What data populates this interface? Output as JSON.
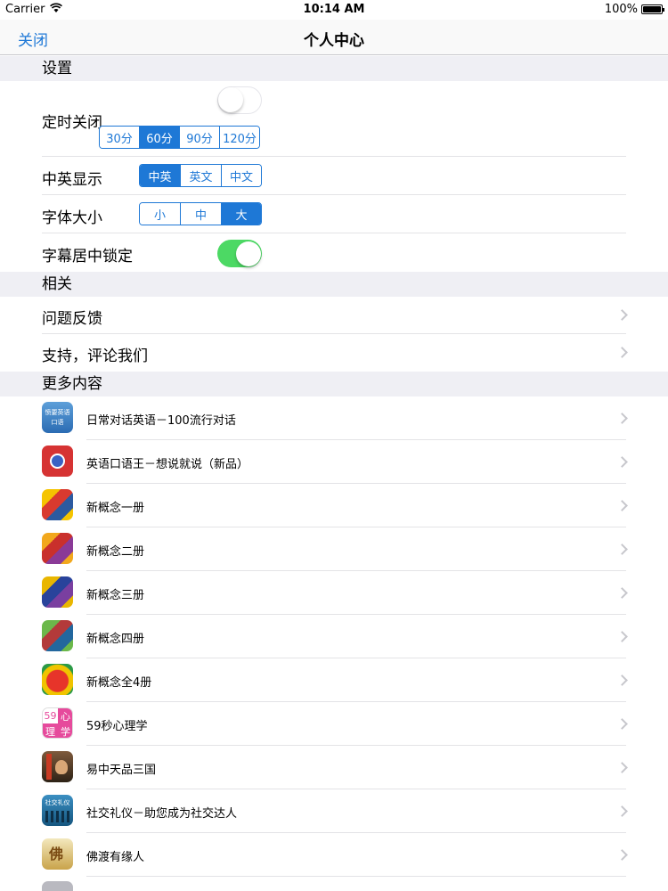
{
  "status": {
    "carrier": "Carrier",
    "time": "10:14 AM",
    "battery": "100%"
  },
  "nav": {
    "close": "关闭",
    "title": "个人中心"
  },
  "sections": {
    "settings": "设置",
    "related": "相关",
    "more": "更多内容"
  },
  "settings": {
    "timer": {
      "label": "定时关闭",
      "toggle_on": false,
      "options": [
        "30分",
        "60分",
        "90分",
        "120分"
      ],
      "selected": "60分"
    },
    "lang": {
      "label": "中英显示",
      "options": [
        "中英",
        "英文",
        "中文"
      ],
      "selected": "中英"
    },
    "font": {
      "label": "字体大小",
      "options": [
        "小",
        "中",
        "大"
      ],
      "selected": "大"
    },
    "lock": {
      "label": "字幕居中锁定",
      "toggle_on": true
    }
  },
  "related": {
    "feedback": "问题反馈",
    "rate": "支持，评论我们"
  },
  "apps": [
    {
      "label": "日常对话英语－100流行对话",
      "icon": "daily-english-app-icon"
    },
    {
      "label": "英语口语王－想说就说（新品）",
      "icon": "spoken-english-app-icon"
    },
    {
      "label": "新概念一册",
      "icon": "new-concept-1-app-icon"
    },
    {
      "label": "新概念二册",
      "icon": "new-concept-2-app-icon"
    },
    {
      "label": "新概念三册",
      "icon": "new-concept-3-app-icon"
    },
    {
      "label": "新概念四册",
      "icon": "new-concept-4-app-icon"
    },
    {
      "label": "新概念全4册",
      "icon": "new-concept-all-app-icon"
    },
    {
      "label": "59秒心理学",
      "icon": "psychology-app-icon"
    },
    {
      "label": "易中天品三国",
      "icon": "three-kingdoms-app-icon"
    },
    {
      "label": "社交礼仪－助您成为社交达人",
      "icon": "etiquette-app-icon"
    },
    {
      "label": "佛渡有缘人",
      "icon": "buddha-app-icon"
    }
  ],
  "icon_text": {
    "app1": [
      "愤要英语",
      "口语"
    ],
    "app8": [
      "59",
      "心",
      "理",
      "学"
    ],
    "app10": "社交礼仪",
    "app11": "佛"
  },
  "colors": {
    "accent": "#1e78d6",
    "toggle_on": "#4cd964",
    "group_bg": "#efeff4"
  }
}
